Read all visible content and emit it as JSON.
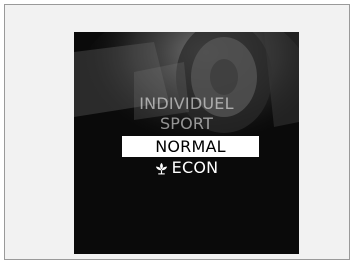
{
  "screen": {
    "menu": {
      "items": [
        {
          "label": "INDIVIDUEL"
        },
        {
          "label": "SPORT"
        },
        {
          "label": "NORMAL",
          "selected": true
        },
        {
          "label": "ECON",
          "icon": "leaf-icon"
        }
      ]
    }
  }
}
